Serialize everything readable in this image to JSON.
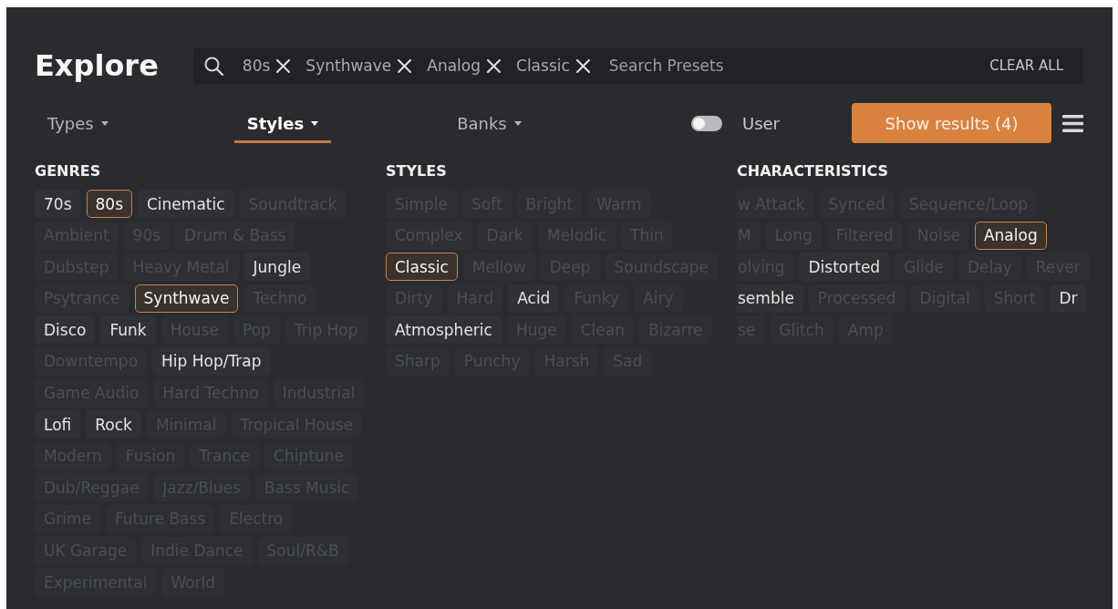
{
  "header": {
    "title": "Explore"
  },
  "search": {
    "tags": [
      "80s",
      "Synthwave",
      "Analog",
      "Classic"
    ],
    "placeholder": "Search Presets",
    "clear_label": "CLEAR ALL"
  },
  "tabs": [
    {
      "label": "Types",
      "selected": false
    },
    {
      "label": "Styles",
      "selected": true
    },
    {
      "label": "Banks",
      "selected": false
    }
  ],
  "user_toggle": {
    "label": "User",
    "on": false
  },
  "show_results": {
    "label": "Show results (4)"
  },
  "sections": [
    {
      "title": "GENRES",
      "rows": [
        {
          "tags": [
            {
              "label": "70s",
              "selected": false,
              "disabled": false
            },
            {
              "label": "80s",
              "selected": true,
              "disabled": false
            },
            {
              "label": "Cinematic",
              "selected": false,
              "disabled": false
            },
            {
              "label": "Soundtrack",
              "selected": false,
              "disabled": true
            }
          ]
        },
        {
          "tags": [
            {
              "label": "Ambient",
              "selected": false,
              "disabled": true
            },
            {
              "label": "90s",
              "selected": false,
              "disabled": true
            },
            {
              "label": "Drum & Bass",
              "selected": false,
              "disabled": true
            }
          ]
        },
        {
          "tags": [
            {
              "label": "Dubstep",
              "selected": false,
              "disabled": true
            },
            {
              "label": "Heavy Metal",
              "selected": false,
              "disabled": true
            },
            {
              "label": "Jungle",
              "selected": false,
              "disabled": false
            }
          ]
        },
        {
          "tags": [
            {
              "label": "Psytrance",
              "selected": false,
              "disabled": true
            },
            {
              "label": "Synthwave",
              "selected": true,
              "disabled": false
            },
            {
              "label": "Techno",
              "selected": false,
              "disabled": true
            }
          ]
        },
        {
          "tags": [
            {
              "label": "Disco",
              "selected": false,
              "disabled": false
            },
            {
              "label": "Funk",
              "selected": false,
              "disabled": false
            },
            {
              "label": "House",
              "selected": false,
              "disabled": true
            },
            {
              "label": "Pop",
              "selected": false,
              "disabled": true
            },
            {
              "label": "Trip Hop",
              "selected": false,
              "disabled": true
            }
          ]
        },
        {
          "tags": [
            {
              "label": "Downtempo",
              "selected": false,
              "disabled": true
            },
            {
              "label": "Hip Hop/Trap",
              "selected": false,
              "disabled": false
            }
          ]
        },
        {
          "tags": [
            {
              "label": "Game Audio",
              "selected": false,
              "disabled": true
            },
            {
              "label": "Hard Techno",
              "selected": false,
              "disabled": true
            },
            {
              "label": "Industrial",
              "selected": false,
              "disabled": true
            }
          ]
        },
        {
          "tags": [
            {
              "label": "Lofi",
              "selected": false,
              "disabled": false
            },
            {
              "label": "Rock",
              "selected": false,
              "disabled": false
            },
            {
              "label": "Minimal",
              "selected": false,
              "disabled": true
            },
            {
              "label": "Tropical House",
              "selected": false,
              "disabled": true
            }
          ]
        },
        {
          "tags": [
            {
              "label": "Modern",
              "selected": false,
              "disabled": true
            },
            {
              "label": "Fusion",
              "selected": false,
              "disabled": true
            },
            {
              "label": "Trance",
              "selected": false,
              "disabled": true
            },
            {
              "label": "Chiptune",
              "selected": false,
              "disabled": true
            }
          ]
        },
        {
          "tags": [
            {
              "label": "Dub/Reggae",
              "selected": false,
              "disabled": true
            },
            {
              "label": "Jazz/Blues",
              "selected": false,
              "disabled": true
            },
            {
              "label": "Bass Music",
              "selected": false,
              "disabled": true
            }
          ]
        },
        {
          "tags": [
            {
              "label": "Grime",
              "selected": false,
              "disabled": true
            },
            {
              "label": "Future Bass",
              "selected": false,
              "disabled": true
            },
            {
              "label": "Electro",
              "selected": false,
              "disabled": true
            }
          ]
        },
        {
          "tags": [
            {
              "label": "UK Garage",
              "selected": false,
              "disabled": true
            },
            {
              "label": "Indie Dance",
              "selected": false,
              "disabled": true
            },
            {
              "label": "Soul/R&B",
              "selected": false,
              "disabled": true
            }
          ]
        },
        {
          "tags": [
            {
              "label": "Experimental",
              "selected": false,
              "disabled": true
            },
            {
              "label": "World",
              "selected": false,
              "disabled": true
            }
          ]
        }
      ]
    },
    {
      "title": "STYLES",
      "rows": [
        {
          "tags": [
            {
              "label": "Simple",
              "selected": false,
              "disabled": true
            },
            {
              "label": "Soft",
              "selected": false,
              "disabled": true
            },
            {
              "label": "Bright",
              "selected": false,
              "disabled": true
            },
            {
              "label": "Warm",
              "selected": false,
              "disabled": true
            }
          ]
        },
        {
          "tags": [
            {
              "label": "Complex",
              "selected": false,
              "disabled": true
            },
            {
              "label": "Dark",
              "selected": false,
              "disabled": true
            },
            {
              "label": "Melodic",
              "selected": false,
              "disabled": true
            },
            {
              "label": "Thin",
              "selected": false,
              "disabled": true
            }
          ]
        },
        {
          "tags": [
            {
              "label": "Classic",
              "selected": true,
              "disabled": false
            },
            {
              "label": "Mellow",
              "selected": false,
              "disabled": true
            },
            {
              "label": "Deep",
              "selected": false,
              "disabled": true
            },
            {
              "label": "Soundscape",
              "selected": false,
              "disabled": true
            }
          ]
        },
        {
          "tags": [
            {
              "label": "Dirty",
              "selected": false,
              "disabled": true
            },
            {
              "label": "Hard",
              "selected": false,
              "disabled": true
            },
            {
              "label": "Acid",
              "selected": false,
              "disabled": false
            },
            {
              "label": "Funky",
              "selected": false,
              "disabled": true
            },
            {
              "label": "Airy",
              "selected": false,
              "disabled": true
            }
          ]
        },
        {
          "tags": [
            {
              "label": "Atmospheric",
              "selected": false,
              "disabled": false
            },
            {
              "label": "Huge",
              "selected": false,
              "disabled": true
            },
            {
              "label": "Clean",
              "selected": false,
              "disabled": true
            },
            {
              "label": "Bizarre",
              "selected": false,
              "disabled": true
            }
          ]
        },
        {
          "tags": [
            {
              "label": "Sharp",
              "selected": false,
              "disabled": true
            },
            {
              "label": "Punchy",
              "selected": false,
              "disabled": true
            },
            {
              "label": "Harsh",
              "selected": false,
              "disabled": true
            },
            {
              "label": "Sad",
              "selected": false,
              "disabled": true
            }
          ]
        }
      ]
    },
    {
      "title": "CHARACTERISTICS",
      "rows": [
        {
          "tags": [
            {
              "label": "w Attack",
              "selected": false,
              "disabled": true
            },
            {
              "label": "Synced",
              "selected": false,
              "disabled": true
            },
            {
              "label": "Sequence/Loop",
              "selected": false,
              "disabled": true
            }
          ]
        },
        {
          "tags": [
            {
              "label": "M",
              "selected": false,
              "disabled": true
            },
            {
              "label": "Long",
              "selected": false,
              "disabled": true
            },
            {
              "label": "Filtered",
              "selected": false,
              "disabled": true
            },
            {
              "label": "Noise",
              "selected": false,
              "disabled": true
            },
            {
              "label": "Analog",
              "selected": true,
              "disabled": false
            }
          ]
        },
        {
          "tags": [
            {
              "label": "olving",
              "selected": false,
              "disabled": true
            },
            {
              "label": "Distorted",
              "selected": false,
              "disabled": false
            },
            {
              "label": "Glide",
              "selected": false,
              "disabled": true
            },
            {
              "label": "Delay",
              "selected": false,
              "disabled": true
            },
            {
              "label": "Rever",
              "selected": false,
              "disabled": true
            }
          ]
        },
        {
          "tags": [
            {
              "label": "semble",
              "selected": false,
              "disabled": false
            },
            {
              "label": "Processed",
              "selected": false,
              "disabled": true
            },
            {
              "label": "Digital",
              "selected": false,
              "disabled": true
            },
            {
              "label": "Short",
              "selected": false,
              "disabled": true
            },
            {
              "label": "Dr",
              "selected": false,
              "disabled": false
            }
          ]
        },
        {
          "tags": [
            {
              "label": "se",
              "selected": false,
              "disabled": true
            },
            {
              "label": "Glitch",
              "selected": false,
              "disabled": true
            },
            {
              "label": "Amp",
              "selected": false,
              "disabled": true
            }
          ]
        }
      ]
    }
  ]
}
